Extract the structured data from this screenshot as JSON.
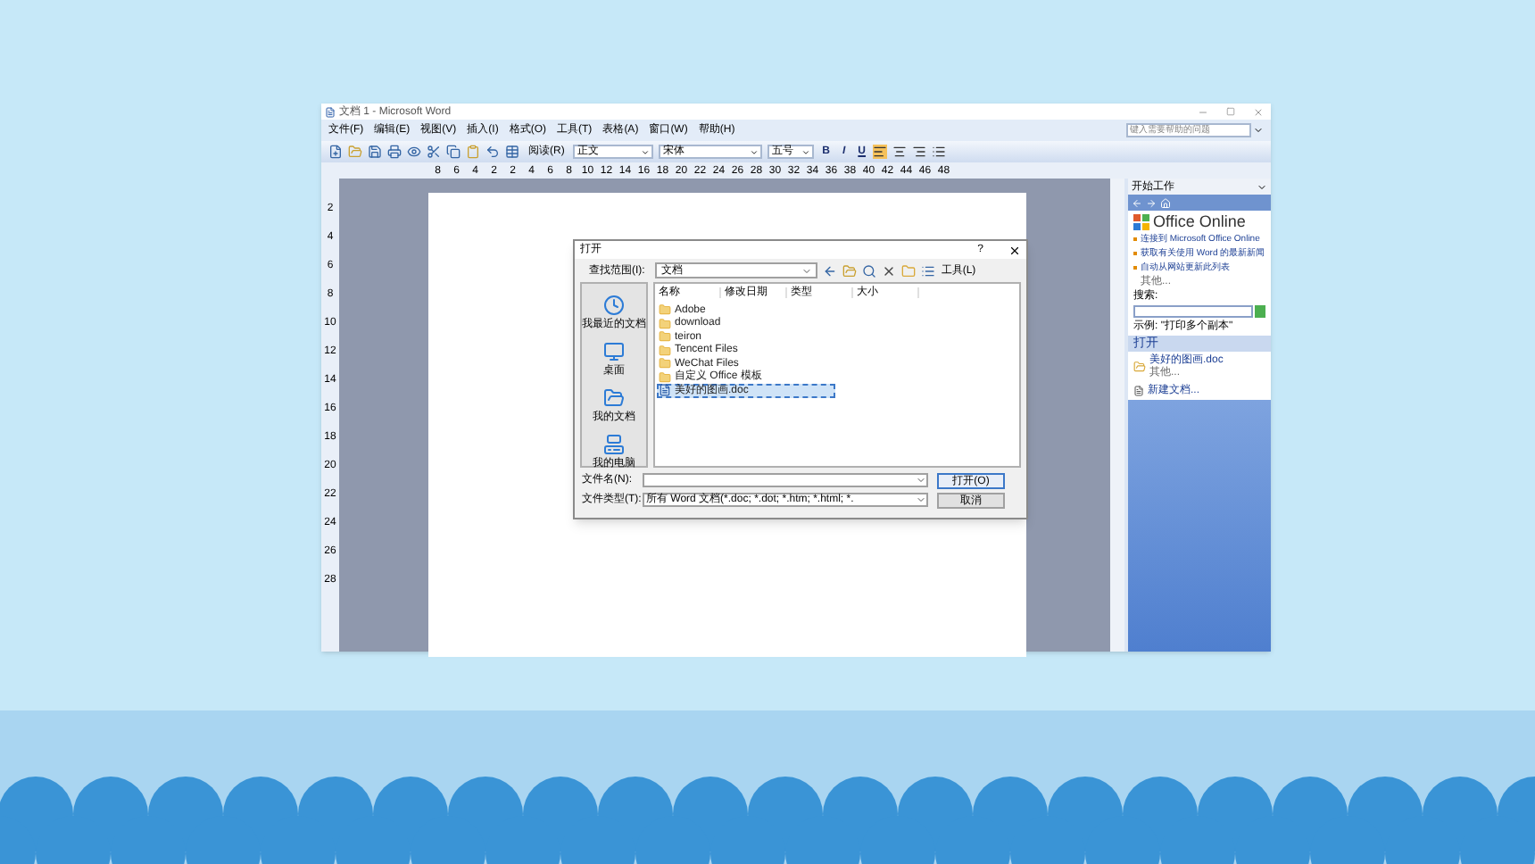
{
  "window": {
    "title": "文档 1 - Microsoft Word"
  },
  "menu": [
    "文件(F)",
    "编辑(E)",
    "视图(V)",
    "插入(I)",
    "格式(O)",
    "工具(T)",
    "表格(A)",
    "窗口(W)",
    "帮助(H)"
  ],
  "help_search": {
    "placeholder": "键入需要帮助的问题"
  },
  "toolbar": {
    "read_button": "阅读(R)",
    "style": "正文",
    "font": "宋体",
    "size": "五号",
    "format_buttons": [
      "B",
      "I",
      "U"
    ]
  },
  "ruler": {
    "numbers": [
      "8",
      "6",
      "4",
      "2",
      "2",
      "4",
      "6",
      "8",
      "10",
      "12",
      "14",
      "16",
      "18",
      "20",
      "22",
      "24",
      "26",
      "28",
      "30",
      "32",
      "34",
      "36",
      "38",
      "40",
      "42",
      "44",
      "46",
      "48"
    ]
  },
  "vertical_ruler": {
    "numbers": [
      "2",
      "4",
      "6",
      "8",
      "10",
      "12",
      "14",
      "16",
      "18",
      "20",
      "22",
      "24",
      "26",
      "28"
    ]
  },
  "dialog": {
    "title": "打开",
    "help": "?",
    "look_in_label": "查找范围(I):",
    "look_in_value": "文档",
    "tools_menu": "工具(L)",
    "places": [
      "我最近的文档",
      "桌面",
      "我的文档",
      "我的电脑"
    ],
    "columns": [
      "名称",
      "修改日期",
      "类型",
      "大小"
    ],
    "files": [
      {
        "name": "Adobe",
        "kind": "folder",
        "selected": false
      },
      {
        "name": "download",
        "kind": "folder",
        "selected": false
      },
      {
        "name": "teiron",
        "kind": "folder",
        "selected": false
      },
      {
        "name": "Tencent Files",
        "kind": "folder",
        "selected": false
      },
      {
        "name": "WeChat Files",
        "kind": "folder",
        "selected": false
      },
      {
        "name": "自定义 Office 模板",
        "kind": "folder",
        "selected": false
      },
      {
        "name": "美好的图画.doc",
        "kind": "document",
        "selected": true
      }
    ],
    "file_name_label": "文件名(N):",
    "file_type_label": "文件类型(T):",
    "file_type_value": "所有 Word 文档(*.doc; *.dot; *.htm; *.html; *.",
    "open_button": "打开(O)",
    "cancel_button": "取消"
  },
  "task_pane": {
    "title": "开始工作",
    "brand": "Office Online",
    "links": [
      "连接到 Microsoft Office Online",
      "获取有关使用 Word 的最新新闻",
      "自动从网站更新此列表"
    ],
    "more": "其他...",
    "search_label": "搜索:",
    "example": "示例: \"打印多个副本\"",
    "open_heading": "打开",
    "recent": "美好的图画.doc",
    "open_more": "其他...",
    "new_document": "新建文档..."
  }
}
